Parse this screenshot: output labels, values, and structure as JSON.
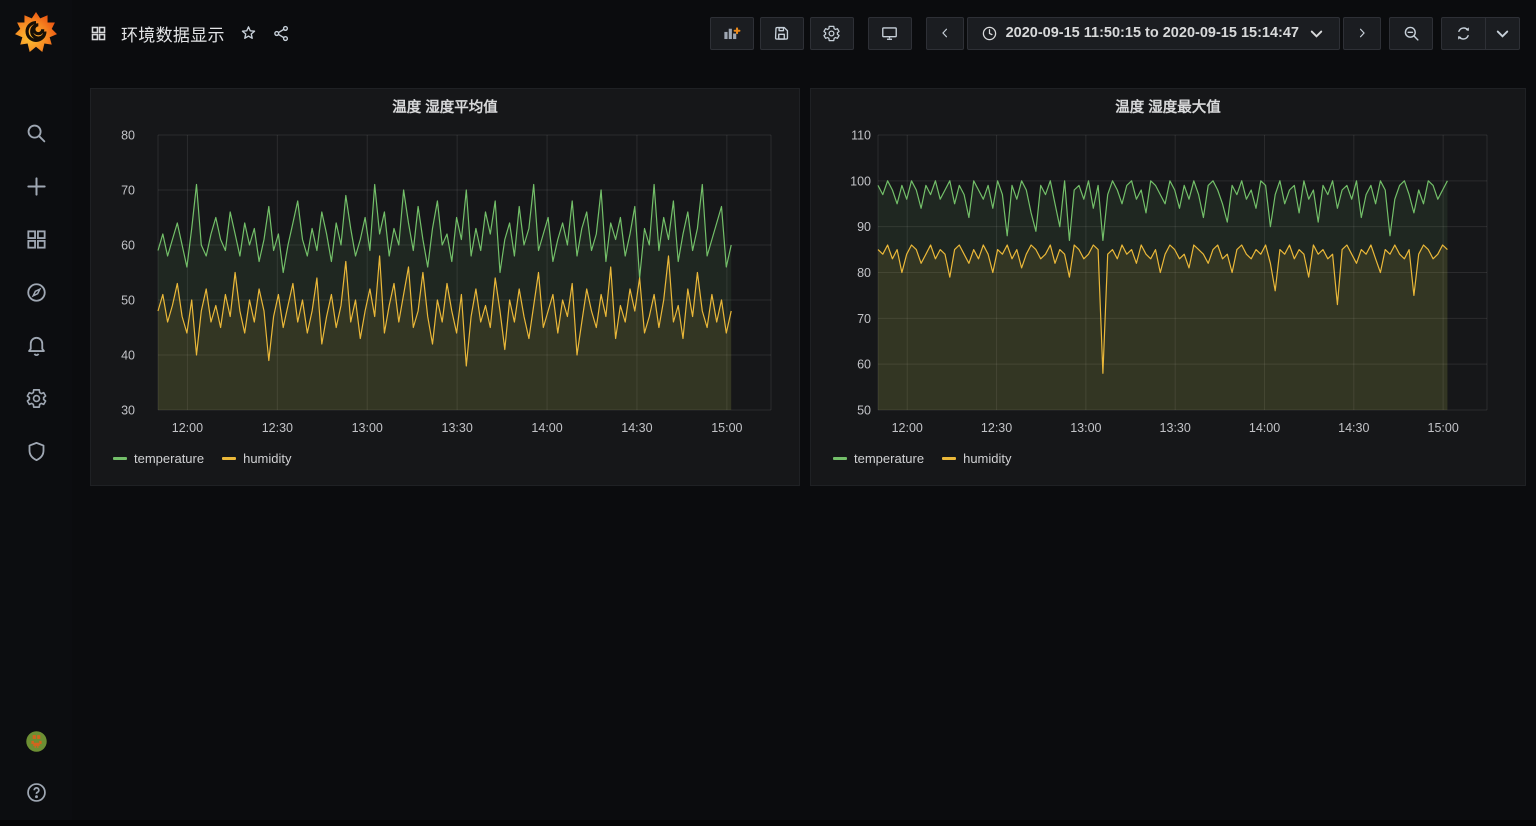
{
  "topbar": {
    "title": "环境数据显示",
    "icons": [
      "dashboards-grid-icon",
      "star-icon",
      "share-icon"
    ],
    "tools": [
      "add-panel",
      "save-dashboard",
      "dashboard-settings",
      "cycle-view-mode"
    ],
    "time_picker": {
      "range_label": "2020-09-15 11:50:15 to 2020-09-15 15:14:47",
      "controls": [
        "time-back",
        "time-forward",
        "zoom-out-time",
        "refresh",
        "refresh-interval-dropdown"
      ]
    }
  },
  "sidebar": {
    "icons": [
      "grafana-logo",
      "search",
      "add",
      "dashboards",
      "explore",
      "alerting",
      "configuration",
      "server-admin",
      "avatar",
      "help"
    ]
  },
  "colors": {
    "temperature": "#73BF69",
    "humidity": "#EAB839",
    "panel_bg": "#161719",
    "page_bg": "#0b0c0e"
  },
  "chart_data": [
    {
      "type": "line",
      "title": "温度 湿度平均值",
      "x_ticks": [
        {
          "label": "12:00",
          "f": 0.048
        },
        {
          "label": "12:30",
          "f": 0.1947
        },
        {
          "label": "13:00",
          "f": 0.3413
        },
        {
          "label": "13:30",
          "f": 0.488
        },
        {
          "label": "14:00",
          "f": 0.6347
        },
        {
          "label": "14:30",
          "f": 0.7813
        },
        {
          "label": "15:00",
          "f": 0.928
        }
      ],
      "data_span": 0.935,
      "ylim": [
        30,
        80
      ],
      "y_ticks": [
        30,
        40,
        50,
        60,
        70,
        80
      ],
      "legend_position": "bottom-left",
      "grid": true,
      "series": [
        {
          "name": "temperature",
          "color": "#73BF69",
          "values": [
            59,
            62,
            58,
            61,
            64,
            60,
            56,
            63,
            71,
            60,
            58,
            62,
            65,
            61,
            59,
            66,
            62,
            58,
            64,
            60,
            63,
            57,
            61,
            67,
            59,
            62,
            55,
            60,
            64,
            68,
            61,
            58,
            63,
            59,
            66,
            62,
            57,
            64,
            60,
            69,
            63,
            58,
            61,
            65,
            59,
            71,
            62,
            66,
            58,
            63,
            60,
            70,
            64,
            59,
            67,
            61,
            56,
            63,
            68,
            60,
            62,
            57,
            65,
            61,
            70,
            58,
            63,
            59,
            66,
            62,
            68,
            55,
            61,
            64,
            58,
            67,
            60,
            63,
            71,
            59,
            62,
            65,
            57,
            61,
            64,
            60,
            68,
            58,
            63,
            66,
            59,
            62,
            70,
            57,
            64,
            61,
            65,
            58,
            62,
            67,
            54,
            63,
            60,
            71,
            59,
            65,
            61,
            68,
            57,
            62,
            66,
            59,
            63,
            71,
            58,
            61,
            64,
            67,
            56,
            60
          ]
        },
        {
          "name": "humidity",
          "color": "#EAB839",
          "values": [
            48,
            51,
            46,
            49,
            53,
            47,
            44,
            50,
            40,
            48,
            52,
            46,
            49,
            45,
            51,
            47,
            55,
            48,
            44,
            50,
            46,
            52,
            48,
            39,
            47,
            51,
            45,
            49,
            53,
            46,
            50,
            44,
            48,
            54,
            42,
            47,
            51,
            45,
            49,
            57,
            46,
            50,
            43,
            48,
            52,
            47,
            58,
            44,
            49,
            53,
            46,
            51,
            56,
            45,
            48,
            55,
            47,
            42,
            50,
            46,
            53,
            48,
            44,
            51,
            38,
            47,
            52,
            46,
            49,
            45,
            54,
            48,
            41,
            50,
            46,
            52,
            47,
            43,
            49,
            55,
            45,
            48,
            51,
            44,
            50,
            47,
            53,
            40,
            46,
            52,
            48,
            45,
            51,
            47,
            56,
            43,
            49,
            46,
            52,
            48,
            54,
            44,
            47,
            51,
            45,
            50,
            58,
            46,
            49,
            43,
            52,
            47,
            55,
            48,
            45,
            51,
            46,
            50,
            44,
            48
          ]
        }
      ]
    },
    {
      "type": "line",
      "title": "温度 湿度最大值",
      "x_ticks": [
        {
          "label": "12:00",
          "f": 0.048
        },
        {
          "label": "12:30",
          "f": 0.1947
        },
        {
          "label": "13:00",
          "f": 0.3413
        },
        {
          "label": "13:30",
          "f": 0.488
        },
        {
          "label": "14:00",
          "f": 0.6347
        },
        {
          "label": "14:30",
          "f": 0.7813
        },
        {
          "label": "15:00",
          "f": 0.928
        }
      ],
      "data_span": 0.935,
      "ylim": [
        50,
        110
      ],
      "y_ticks": [
        50,
        60,
        70,
        80,
        90,
        100,
        110
      ],
      "legend_position": "bottom-left",
      "grid": true,
      "series": [
        {
          "name": "temperature",
          "color": "#73BF69",
          "values": [
            99,
            97,
            100,
            98,
            95,
            99,
            96,
            100,
            98,
            94,
            99,
            97,
            100,
            96,
            98,
            100,
            95,
            99,
            97,
            92,
            100,
            98,
            96,
            99,
            94,
            100,
            97,
            88,
            99,
            96,
            100,
            98,
            93,
            89,
            99,
            97,
            100,
            95,
            90,
            100,
            87,
            98,
            99,
            96,
            100,
            94,
            99,
            87,
            97,
            100,
            98,
            95,
            99,
            100,
            96,
            98,
            93,
            100,
            99,
            97,
            95,
            100,
            98,
            94,
            99,
            96,
            100,
            97,
            92,
            99,
            100,
            98,
            95,
            91,
            99,
            97,
            100,
            96,
            98,
            94,
            100,
            99,
            90,
            97,
            100,
            95,
            98,
            99,
            93,
            100,
            96,
            98,
            91,
            99,
            97,
            100,
            94,
            98,
            99,
            96,
            100,
            92,
            97,
            99,
            95,
            100,
            98,
            88,
            96,
            99,
            100,
            97,
            93,
            98,
            95,
            100,
            99,
            96,
            98,
            100
          ]
        },
        {
          "name": "humidity",
          "color": "#EAB839",
          "values": [
            85,
            84,
            86,
            83,
            85,
            80,
            84,
            86,
            85,
            82,
            84,
            86,
            83,
            85,
            84,
            79,
            85,
            86,
            84,
            82,
            85,
            83,
            86,
            84,
            80,
            85,
            84,
            86,
            83,
            85,
            81,
            84,
            86,
            85,
            83,
            84,
            86,
            82,
            85,
            84,
            79,
            86,
            85,
            83,
            84,
            86,
            85,
            58,
            84,
            85,
            83,
            86,
            84,
            85,
            82,
            86,
            84,
            83,
            85,
            80,
            84,
            86,
            85,
            83,
            84,
            81,
            86,
            85,
            84,
            82,
            85,
            86,
            83,
            84,
            80,
            85,
            86,
            84,
            83,
            85,
            84,
            86,
            82,
            76,
            85,
            84,
            86,
            83,
            85,
            84,
            79,
            86,
            84,
            85,
            83,
            84,
            73,
            85,
            86,
            84,
            82,
            85,
            84,
            86,
            83,
            80,
            85,
            84,
            86,
            84,
            83,
            85,
            75,
            84,
            86,
            85,
            83,
            84,
            86,
            85
          ]
        }
      ]
    }
  ]
}
